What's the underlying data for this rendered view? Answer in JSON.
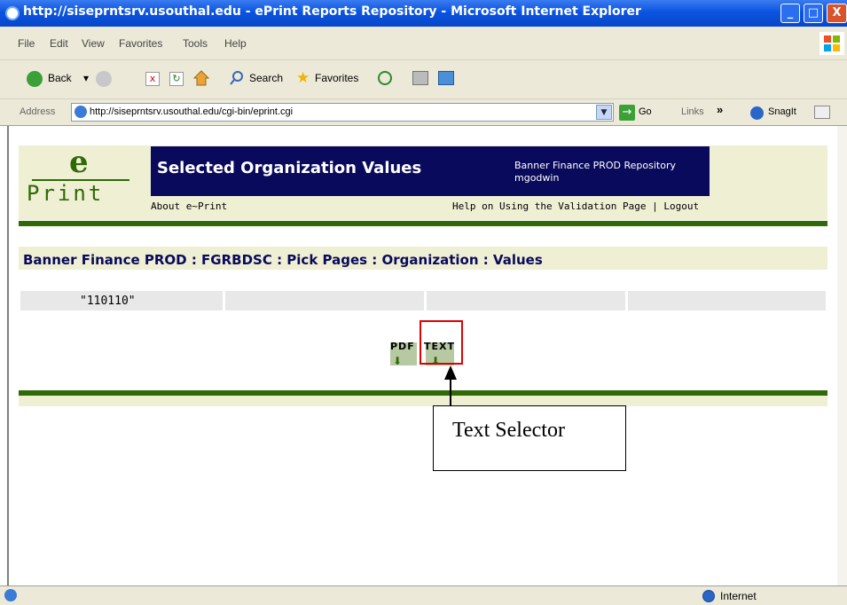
{
  "window": {
    "title": "http://siseprntsrv.usouthal.edu - ePrint Reports Repository - Microsoft Internet Explorer",
    "minimize": "_",
    "maximize": "□",
    "close": "X"
  },
  "menu": [
    "File",
    "Edit",
    "View",
    "Favorites",
    "Tools",
    "Help"
  ],
  "toolbar": {
    "back": "Back",
    "search": "Search",
    "favorites": "Favorites"
  },
  "address": {
    "label": "Address",
    "url": "http://siseprntsrv.usouthal.edu/cgi-bin/eprint.cgi",
    "go": "Go",
    "links": "Links",
    "chevron": "»",
    "snagit": "SnagIt"
  },
  "eprint": {
    "logo_top": "e",
    "logo_bottom": "Print",
    "header_title": "Selected Organization Values",
    "repository": "Banner Finance PROD Repository",
    "user": "mgodwin",
    "about": "About e~Print",
    "help": "Help on Using the Validation Page | Logout",
    "breadcrumb": "Banner Finance PROD : FGRBDSC : Pick Pages : Organization : Values",
    "value": "\"110110\"",
    "pdf": "PDF",
    "text": "TEXT"
  },
  "annotation": {
    "callout": "Text Selector"
  },
  "status": {
    "zone": "Internet"
  },
  "colors": {
    "titlebar": "#0a54e0",
    "navy": "#0a0a5c",
    "green": "#2f6a06",
    "beige": "#efefd4",
    "highlight": "#e00000"
  }
}
